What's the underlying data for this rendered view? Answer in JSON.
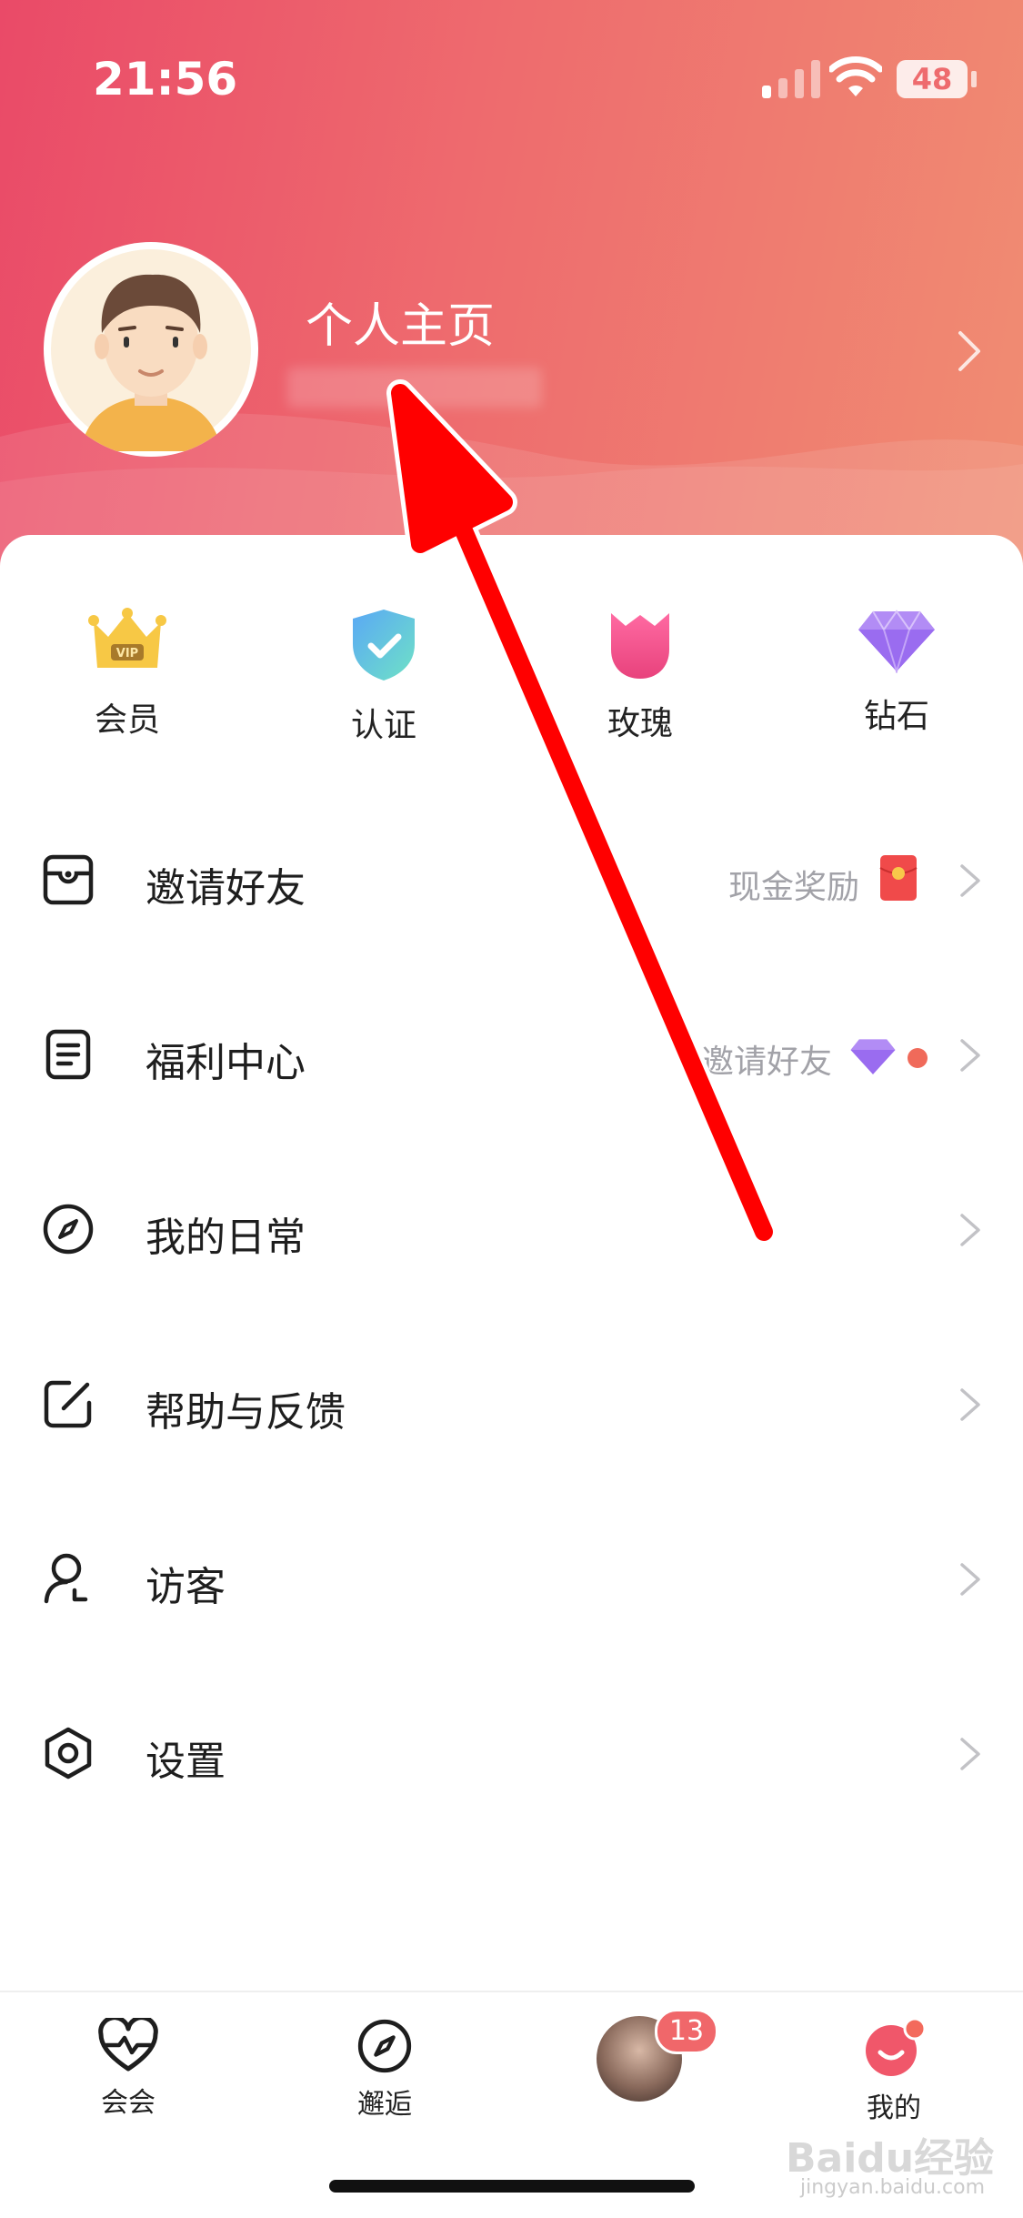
{
  "status_bar": {
    "time": "21:56",
    "battery": "48"
  },
  "profile": {
    "title": "个人主页"
  },
  "quick_actions": [
    {
      "label": "会员",
      "icon": "vip-crown-icon"
    },
    {
      "label": "认证",
      "icon": "verified-shield-icon"
    },
    {
      "label": "玫瑰",
      "icon": "rose-icon"
    },
    {
      "label": "钻石",
      "icon": "diamond-icon"
    }
  ],
  "menu": [
    {
      "label": "邀请好友",
      "icon": "wallet-icon",
      "extra": "现金奖励"
    },
    {
      "label": "福利中心",
      "icon": "document-icon",
      "extra": "邀请好友"
    },
    {
      "label": "我的日常",
      "icon": "compass-icon"
    },
    {
      "label": "帮助与反馈",
      "icon": "edit-icon"
    },
    {
      "label": "访客",
      "icon": "visitor-icon"
    },
    {
      "label": "设置",
      "icon": "settings-icon"
    }
  ],
  "tabbar": {
    "tabs": [
      {
        "label": "会会",
        "icon": "heart-pulse-icon"
      },
      {
        "label": "邂逅",
        "icon": "compass-icon"
      },
      {
        "label": "",
        "icon": "avatar"
      },
      {
        "label": "我的",
        "icon": "smile-icon"
      }
    ],
    "badge": "13"
  },
  "watermark": {
    "brand": "Baidu经验",
    "url": "jingyan.baidu.com"
  },
  "colors": {
    "accent": "#ee6b6e",
    "header_start": "#ea4a68",
    "header_end": "#f08d72",
    "arrow": "#ff0000"
  }
}
